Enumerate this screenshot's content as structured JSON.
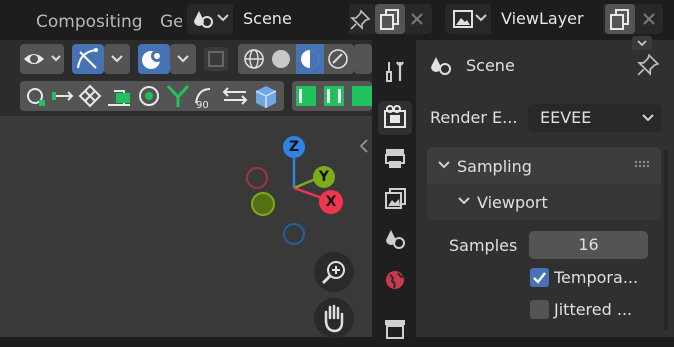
{
  "topbar": {
    "tab_compositing": "Compositing",
    "tab_partial": "Ge",
    "scene_name": "Scene",
    "viewlayer_name": "ViewLayer"
  },
  "gizmo": {
    "z_label": "Z",
    "y_label": "Y",
    "x_label": "X",
    "colors": {
      "z": "#2f84e3",
      "y": "#7fac1c",
      "x": "#f0364f"
    }
  },
  "properties": {
    "header_title": "Scene",
    "render_engine_label": "Render E...",
    "render_engine_value": "EEVEE",
    "sampling_label": "Sampling",
    "viewport_label": "Viewport",
    "samples_label": "Samples",
    "samples_value": "16",
    "temporal_label": "Tempora...",
    "temporal_checked": true,
    "jittered_label": "Jittered ...",
    "jittered_checked": false
  },
  "accent": "#4772b3"
}
